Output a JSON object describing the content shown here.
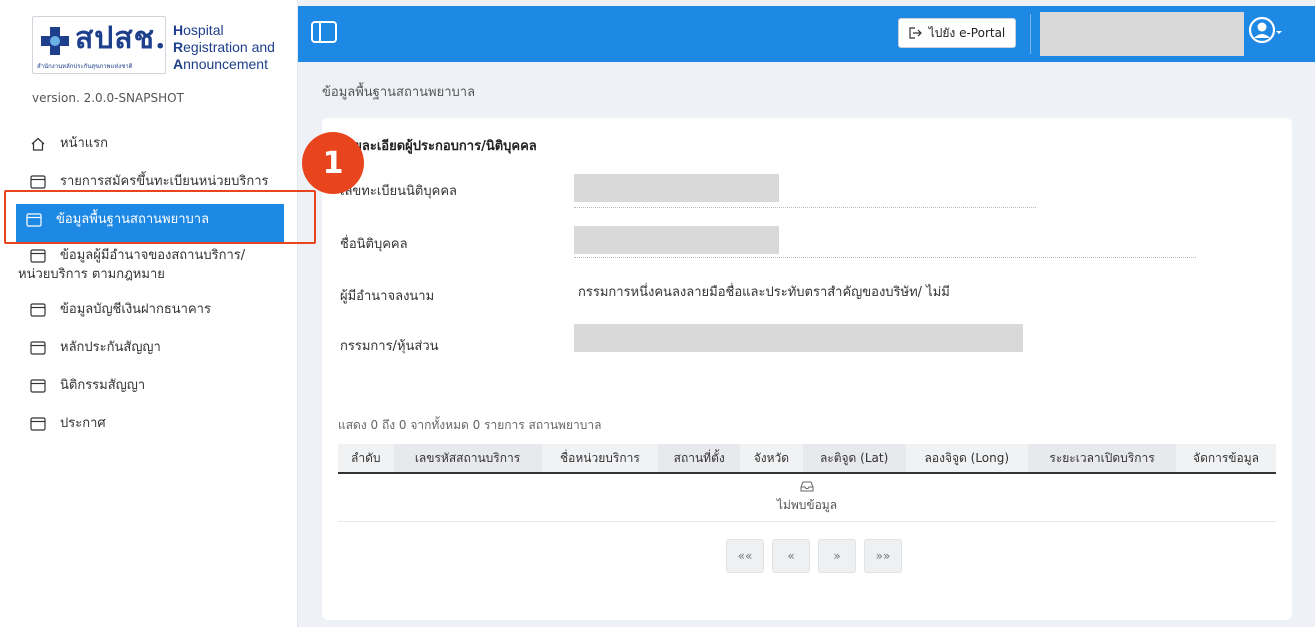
{
  "brand": {
    "logo_text": "สปสช.",
    "logo_subtitle": "สำนักงานหลักประกันสุขภาพแห่งชาติ",
    "name_line1_cap": "H",
    "name_line1_rest": "ospital",
    "name_line2_cap": "R",
    "name_line2_rest": "egistration and",
    "name_line3_cap": "A",
    "name_line3_rest": "nnouncement",
    "version": "version. 2.0.0-SNAPSHOT"
  },
  "menu": {
    "home": "หน้าแรก",
    "registration_list": "รายการสมัครขึ้นทะเบียนหน่วยบริการ",
    "hospital_info": "ข้อมูลพื้นฐานสถานพยาบาล",
    "authority_line1": "ข้อมูลผู้มีอำนาจของสถานบริการ/",
    "authority_line2": "หน่วยบริการ ตามกฎหมาย",
    "bank": "ข้อมูลบัญชีเงินฝากธนาคาร",
    "guarantee": "หลักประกันสัญญา",
    "contract": "นิติกรรมสัญญา",
    "announcement": "ประกาศ"
  },
  "annotation": {
    "step": "1"
  },
  "header": {
    "portal_label": "ไปยัง e-Portal"
  },
  "breadcrumb": "ข้อมูลพื้นฐานสถานพยาบาล",
  "card": {
    "title": "รายละเอียดผู้ประกอบการ/นิติบุคคล",
    "fields": {
      "reg_no_label": "เลขทะเบียนนิติบุคคล",
      "name_label": "ชื่อนิติบุคคล",
      "signer_label": "ผู้มีอำนาจลงนาม",
      "signer_value": "กรรมการหนึ่งคนลงลายมือชื่อและประทับตราสำคัญของบริษัท/ ไม่มี",
      "directors_label": "กรรมการ/หุ้นส่วน"
    },
    "summary": "แสดง 0 ถึง 0 จากทั้งหมด 0 รายการ สถานพยาบาล",
    "table": {
      "columns": [
        "ลำดับ",
        "เลขรหัสสถานบริการ",
        "ชื่อหน่วยบริการ",
        "สถานที่ตั้ง",
        "จังหวัด",
        "ละติจูด (Lat)",
        "ลองจิจูด (Long)",
        "ระยะเวลาเปิดบริการ",
        "จัดการข้อมูล"
      ],
      "empty_text": "ไม่พบข้อมูล"
    },
    "pager": {
      "first": "««",
      "prev": "«",
      "next": "»",
      "last": "»»"
    }
  },
  "colors": {
    "primary": "#1e88e5",
    "annotation": "#e8451e",
    "brand": "#1e3f8c"
  }
}
